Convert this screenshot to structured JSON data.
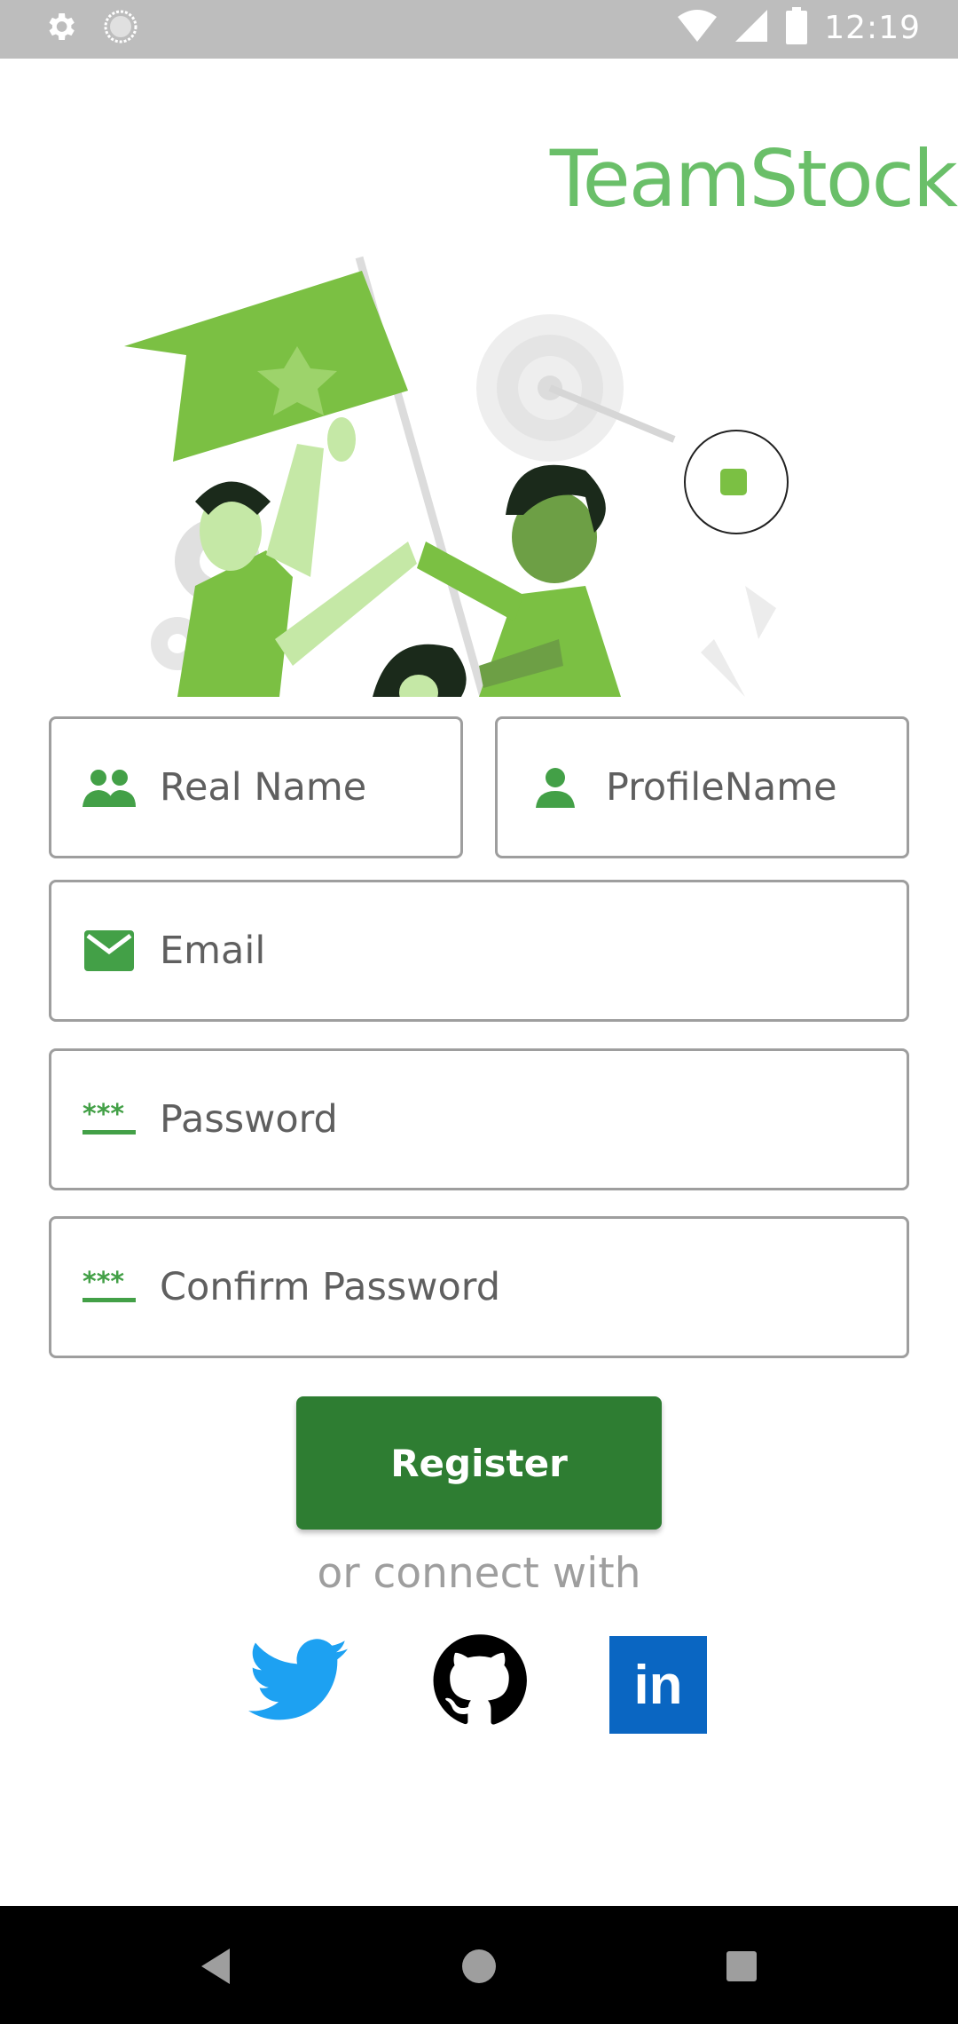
{
  "status_bar": {
    "time": "12:19",
    "icons": [
      "gear-icon",
      "circle-icon",
      "wifi-icon",
      "signal-icon",
      "battery-icon"
    ]
  },
  "brand": {
    "title": "TeamStock",
    "color": "#6abf69"
  },
  "form": {
    "real_name": {
      "placeholder": "Real Name",
      "icon": "group-icon"
    },
    "profile_name": {
      "placeholder": "ProfileName",
      "icon": "person-icon"
    },
    "email": {
      "placeholder": "Email",
      "icon": "mail-icon"
    },
    "password": {
      "placeholder": "Password",
      "icon": "password-icon"
    },
    "confirm_password": {
      "placeholder": "Confirm Password",
      "icon": "password-icon"
    }
  },
  "actions": {
    "register_label": "Register",
    "accent": "#2e7d32"
  },
  "social": {
    "caption": "or connect with",
    "providers": [
      "twitter-icon",
      "github-icon",
      "linkedin-icon"
    ],
    "linkedin_text": "in"
  },
  "nav": {
    "icons": [
      "back-icon",
      "home-icon",
      "recents-icon"
    ]
  }
}
